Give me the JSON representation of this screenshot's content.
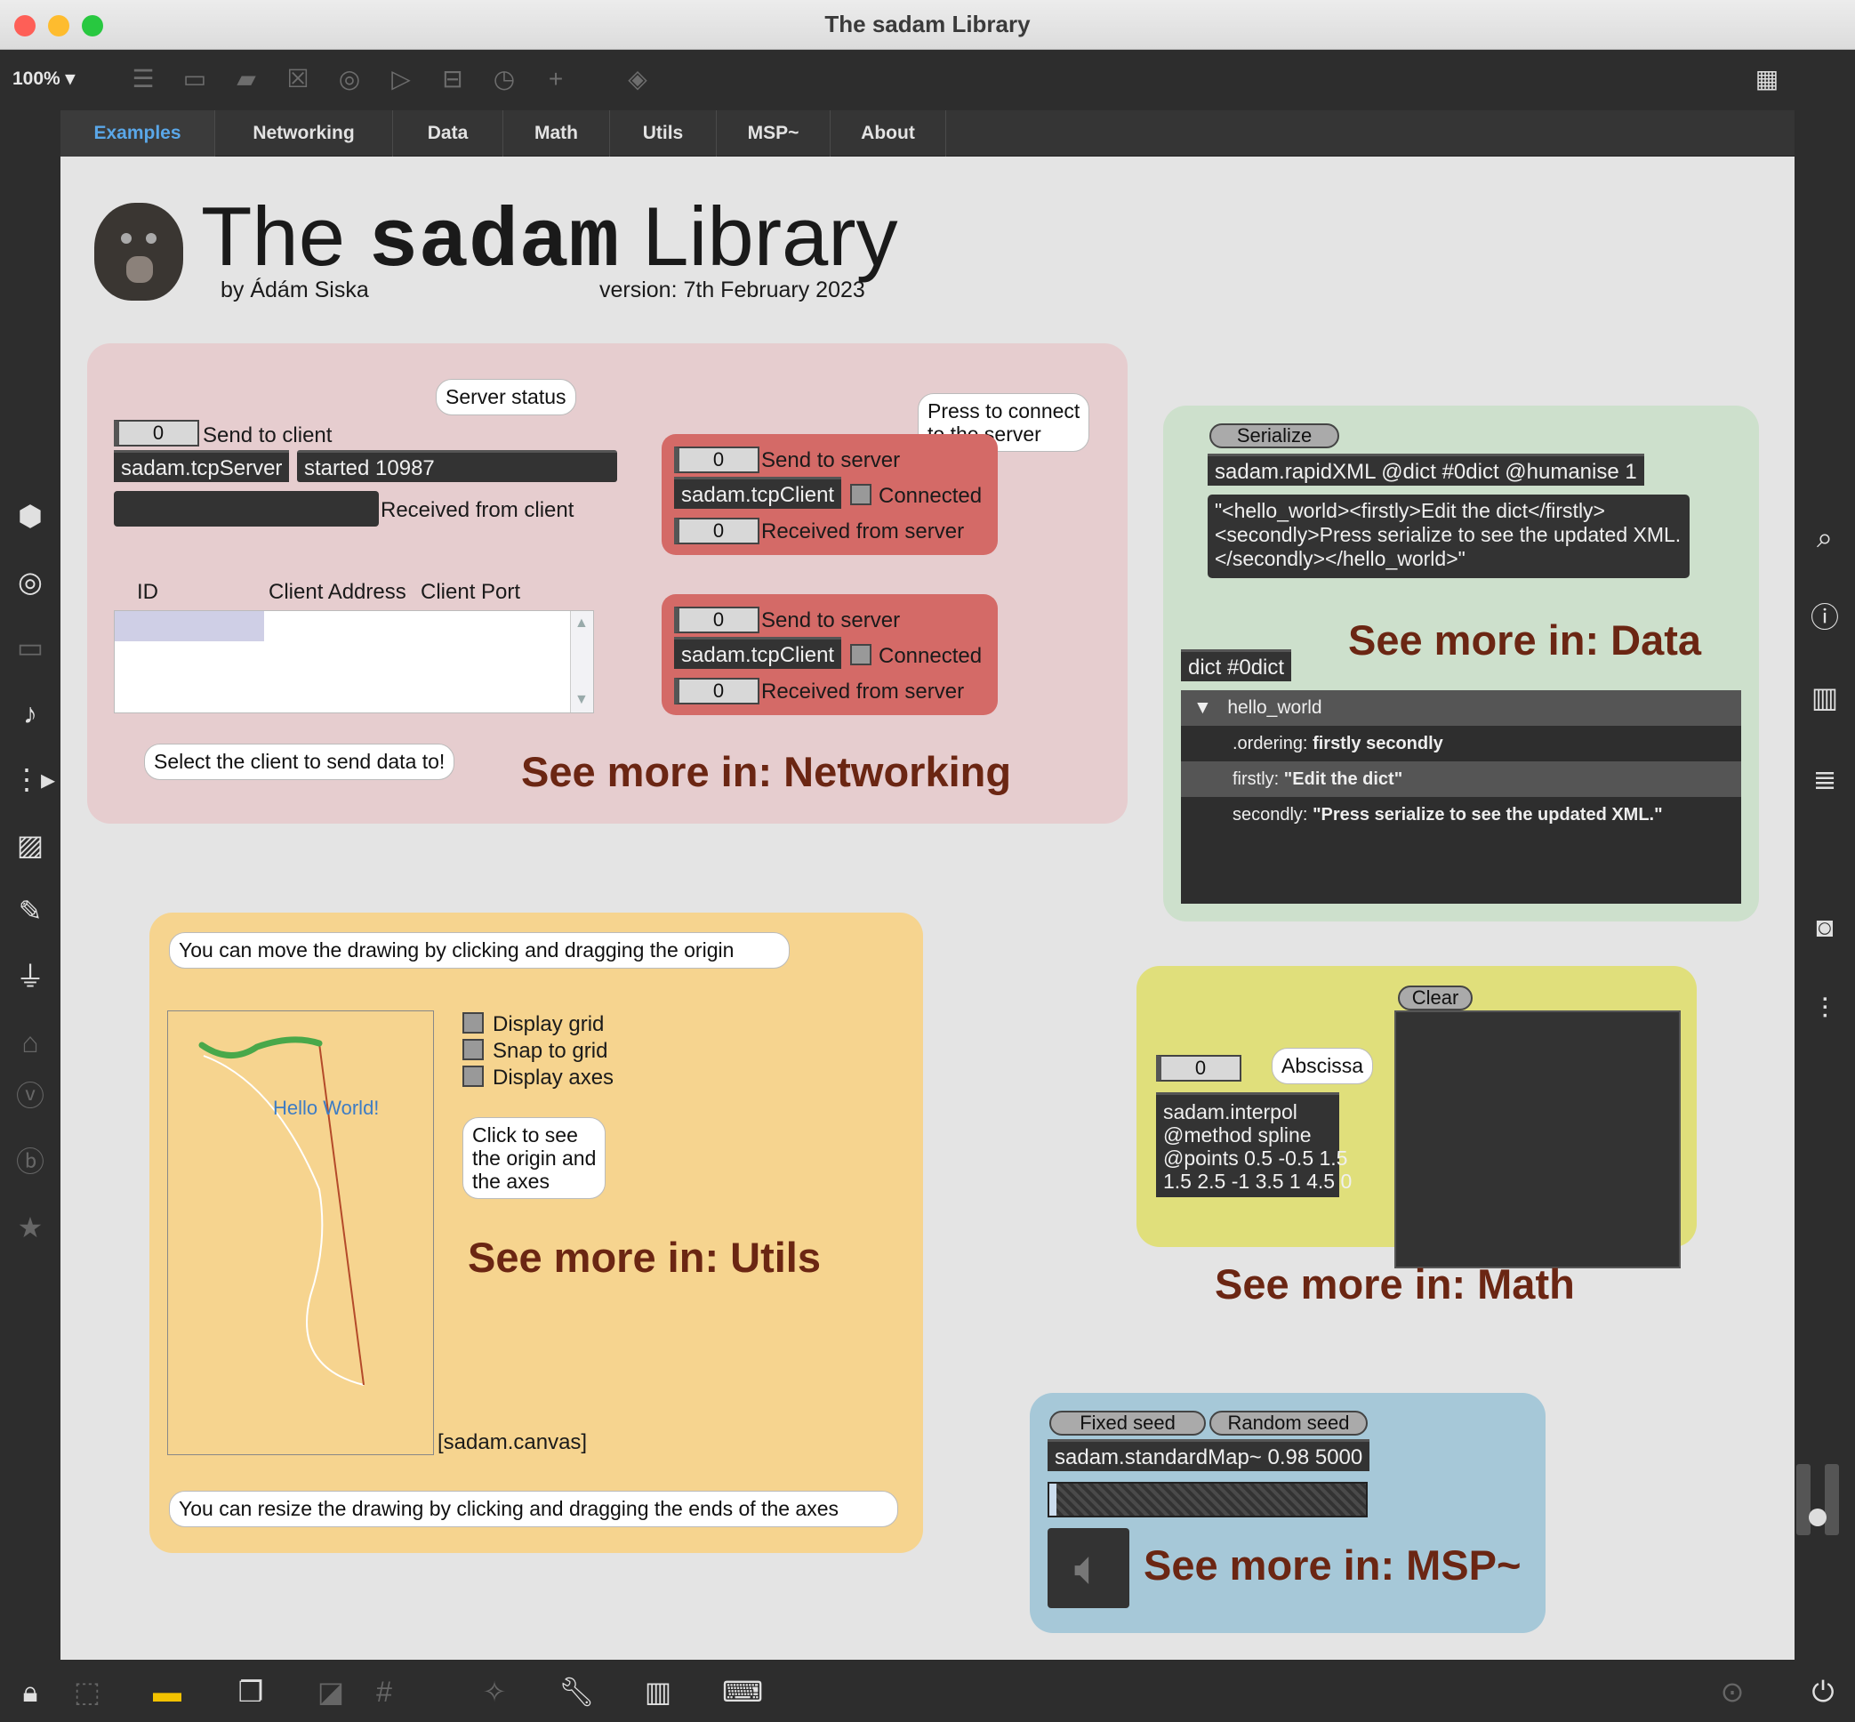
{
  "window": {
    "title": "The sadam Library"
  },
  "toolbar": {
    "zoom": "100%"
  },
  "tabs": [
    "Examples",
    "Networking",
    "Data",
    "Math",
    "Utils",
    "MSP~",
    "About"
  ],
  "header": {
    "title_pre": "The ",
    "title_mono": "sadam",
    "title_post": " Library",
    "author": "by Ádám Siska",
    "version": "version: 7th February 2023"
  },
  "networking": {
    "server_status_bubble": "Server status",
    "send_to_client_value": "0",
    "send_to_client_label": "Send to client",
    "server_object": "sadam.tcpServer",
    "server_status": "started 10987",
    "received_from_client_label": "Received from client",
    "col_id": "ID",
    "col_address": "Client Address",
    "col_port": "Client Port",
    "select_client_bubble": "Select the client to send data to!",
    "press_connect_bubble_line1": "Press to connect",
    "press_connect_bubble_line2": "to the server",
    "client1": {
      "send_value": "0",
      "send_label": "Send to server",
      "object": "sadam.tcpClient",
      "connected_label": "Connected",
      "recv_value": "0",
      "recv_label": "Received from server"
    },
    "client2": {
      "send_value": "0",
      "send_label": "Send to server",
      "object": "sadam.tcpClient",
      "connected_label": "Connected",
      "recv_value": "0",
      "recv_label": "Received from server"
    },
    "see_more": "See more in: Networking"
  },
  "data": {
    "serialize_button": "Serialize",
    "rapidxml_object": "sadam.rapidXML @dict #0dict @humanise 1",
    "xml_message": "\"<hello_world><firstly>Edit the dict</firstly><secondly>Press serialize to see the updated XML.</secondly></hello_world>\"",
    "see_more": "See more in: Data",
    "dict_object": "dict #0dict",
    "tree": {
      "root": "hello_world",
      "rows": [
        {
          "key": ".ordering:",
          "value": "firstly secondly"
        },
        {
          "key": "firstly:",
          "value": "\"Edit the dict\""
        },
        {
          "key": "secondly:",
          "value": "\"Press serialize to see the updated XML.\""
        }
      ]
    }
  },
  "utils": {
    "move_bubble": "You can move the drawing by clicking and dragging the origin",
    "hello_text": "Hello World!",
    "display_grid": "Display grid",
    "snap_to_grid": "Snap to grid",
    "display_axes": "Display axes",
    "click_bubble_line1": "Click to see",
    "click_bubble_line2": "the origin and",
    "click_bubble_line3": "the axes",
    "see_more": "See more in: Utils",
    "canvas_label": "[sadam.canvas]",
    "resize_bubble": "You can resize the drawing by clicking and dragging the ends of the axes"
  },
  "math": {
    "clear_button": "Clear",
    "abscissa_value": "0",
    "abscissa_bubble": "Abscissa",
    "interpol_line1": "sadam.interpol",
    "interpol_line2": "@method spline",
    "interpol_line3": "@points 0.5 -0.5 1.5",
    "interpol_line4": "1.5 2.5 -1 3.5 1 4.5 0",
    "see_more": "See more in: Math"
  },
  "msp": {
    "fixed_seed": "Fixed seed",
    "random_seed": "Random seed",
    "object": "sadam.standardMap~ 0.98 5000",
    "see_more": "See more in: MSP~"
  },
  "colors": {
    "networking_panel": "#e6cdcf",
    "client_panel": "#d46a67",
    "data_panel": "#cde0cc",
    "utils_panel": "#f6d48f",
    "math_panel": "#e0df7b",
    "msp_panel": "#a6c8d8",
    "see_more": "#6b2613",
    "active_tab": "#5aa7e8"
  }
}
